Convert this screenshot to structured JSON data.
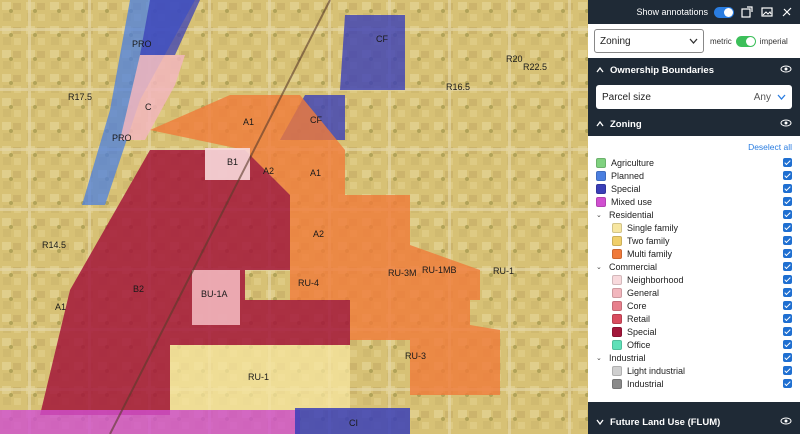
{
  "map": {
    "labels": [
      {
        "text": "PRO",
        "id": "pro-1"
      },
      {
        "text": "CF",
        "id": "cf-1"
      },
      {
        "text": "R20",
        "id": "r20"
      },
      {
        "text": "R22.5",
        "id": "r225"
      },
      {
        "text": "R17.5",
        "id": "r175"
      },
      {
        "text": "R16.5",
        "id": "r165"
      },
      {
        "text": "C",
        "id": "c"
      },
      {
        "text": "A1",
        "id": "a1-1"
      },
      {
        "text": "CF",
        "id": "cf-2"
      },
      {
        "text": "PRO",
        "id": "pro-2"
      },
      {
        "text": "B1",
        "id": "b1"
      },
      {
        "text": "A2",
        "id": "a2-1"
      },
      {
        "text": "A1",
        "id": "a1-2"
      },
      {
        "text": "A2",
        "id": "a2-2"
      },
      {
        "text": "R14.5",
        "id": "r145"
      },
      {
        "text": "RU-3M",
        "id": "ru3m"
      },
      {
        "text": "RU-1MB",
        "id": "ru1mb"
      },
      {
        "text": "RU-1",
        "id": "ru1-1"
      },
      {
        "text": "B2",
        "id": "b2"
      },
      {
        "text": "BU-1A",
        "id": "bu1a"
      },
      {
        "text": "RU-4",
        "id": "ru4"
      },
      {
        "text": "A1",
        "id": "a1-3"
      },
      {
        "text": "RU-3",
        "id": "ru3"
      },
      {
        "text": "RU-1",
        "id": "ru1-2"
      },
      {
        "text": "CI",
        "id": "ci"
      }
    ]
  },
  "toolbar": {
    "show_annotations": "Show annotations"
  },
  "zoning_select": {
    "value": "Zoning",
    "metric": "metric",
    "imperial": "imperial"
  },
  "ownership": {
    "title": "Ownership Boundaries",
    "parcel_label": "Parcel size",
    "parcel_value": "Any"
  },
  "zoning": {
    "title": "Zoning",
    "deselect": "Deselect all",
    "items": [
      {
        "label": "Agriculture",
        "color": "#7fd17f",
        "level": 0
      },
      {
        "label": "Planned",
        "color": "#4b7fe0",
        "level": 0
      },
      {
        "label": "Special",
        "color": "#3a3fb8",
        "level": 0
      },
      {
        "label": "Mixed use",
        "color": "#d04fd0",
        "level": 0
      }
    ],
    "groups": [
      {
        "label": "Residential",
        "items": [
          {
            "label": "Single family",
            "color": "#f7e6a0"
          },
          {
            "label": "Two family",
            "color": "#f0cf6a"
          },
          {
            "label": "Multi family",
            "color": "#f07a3a"
          }
        ]
      },
      {
        "label": "Commercial",
        "items": [
          {
            "label": "Neighborhood",
            "color": "#f8d9dc"
          },
          {
            "label": "General",
            "color": "#f2b6bd"
          },
          {
            "label": "Core",
            "color": "#e77f8c"
          },
          {
            "label": "Retail",
            "color": "#d94c5f"
          },
          {
            "label": "Special",
            "color": "#a3163a"
          },
          {
            "label": "Office",
            "color": "#5fe0b8"
          }
        ]
      },
      {
        "label": "Industrial",
        "items": [
          {
            "label": "Light industrial",
            "color": "#cfcfcf"
          },
          {
            "label": "Industrial",
            "color": "#8a8a8a"
          }
        ]
      }
    ]
  },
  "flum": {
    "title": "Future Land Use (FLUM)"
  },
  "colors": {
    "accent": "#2a7de1",
    "panel_bg": "#1f2a36"
  }
}
